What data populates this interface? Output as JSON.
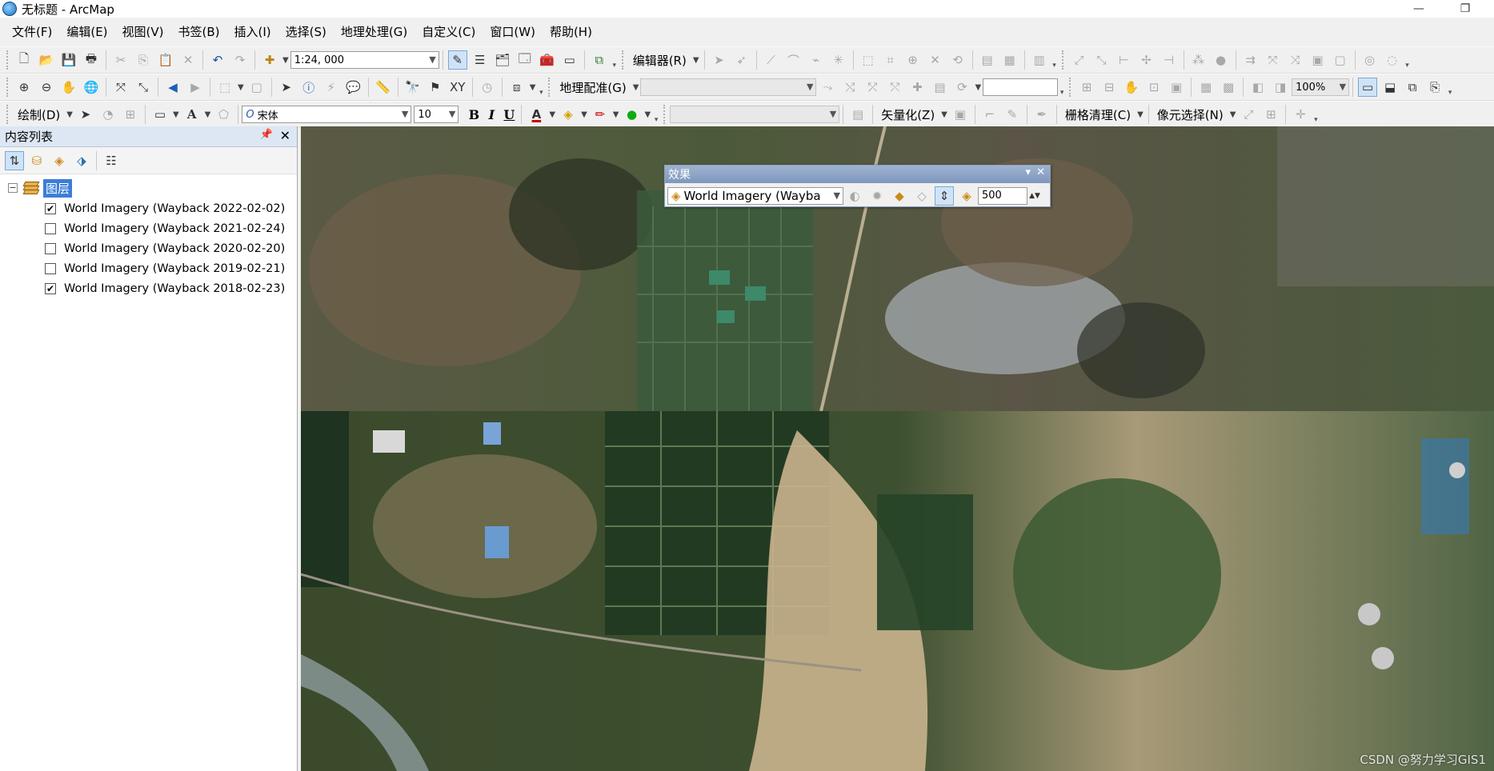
{
  "window": {
    "title": "无标题 - ArcMap",
    "minimize": "—",
    "restore": "❐"
  },
  "menu": [
    "文件(F)",
    "编辑(E)",
    "视图(V)",
    "书签(B)",
    "插入(I)",
    "选择(S)",
    "地理处理(G)",
    "自定义(C)",
    "窗口(W)",
    "帮助(H)"
  ],
  "toolbar1": {
    "scale": "1:24, 000",
    "editor_label": "编辑器(R)"
  },
  "toolbar2": {
    "georef_label": "地理配准(G)",
    "zoom_pct": "100%"
  },
  "toolbar3": {
    "draw_label": "绘制(D)",
    "font_name": "宋体",
    "font_size": "10",
    "bold": "B",
    "italic": "I",
    "underline": "U",
    "vectorize_label": "矢量化(Z)",
    "raster_cleanup_label": "栅格清理(C)",
    "pixel_select_label": "像元选择(N)"
  },
  "toc": {
    "title": "内容列表",
    "group_label": "图层",
    "layers": [
      {
        "label": "World Imagery (Wayback 2022-02-02)",
        "checked": true
      },
      {
        "label": "World Imagery (Wayback 2021-02-24)",
        "checked": false
      },
      {
        "label": "World Imagery (Wayback 2020-02-20)",
        "checked": false
      },
      {
        "label": "World Imagery (Wayback 2019-02-21)",
        "checked": false
      },
      {
        "label": "World Imagery (Wayback 2018-02-23)",
        "checked": true
      }
    ]
  },
  "effects": {
    "title": "效果",
    "layer_select": "World Imagery (Wayba",
    "value": "500"
  },
  "watermark": "CSDN @努力学习GIS1"
}
